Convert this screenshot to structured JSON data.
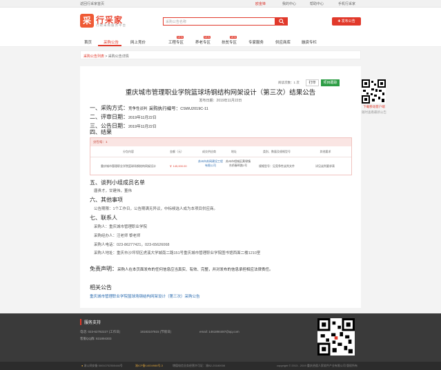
{
  "topbar": {
    "home_link": "返回行采家首页",
    "user": "欧金锋",
    "links": [
      "我的中心",
      "帮助中心",
      "手机行采家"
    ]
  },
  "header": {
    "logo_glyph": "采",
    "logo_title": "行采家",
    "logo_sub": "行政采购服务平台",
    "search_placeholder": "采购公告名称",
    "publish_label": "发布公告"
  },
  "nav": {
    "items": [
      "首页",
      "采购公告",
      "网上竞价",
      "工程专区",
      "养老专区",
      "扶贫专区",
      "专家服务",
      "供应商库",
      "融资专栏"
    ],
    "badges": [
      "NEW",
      "NEW",
      "NEW"
    ]
  },
  "breadcrumb": {
    "list_link": "采购公告列表",
    "separator": ">",
    "current": "采购公告详情"
  },
  "article": {
    "views": "阅读次数：1 次",
    "print_label": "打印",
    "follow_label": "项目跟踪",
    "title": "重庆城市管理职业学院篮球场钢结构网架设计（第三次）结果公告",
    "publish_date": "发布日期：2019年11月22日",
    "s1_label": "一、采购方式：",
    "s1_value": "竞争性谈判",
    "s1_code_label": "采购执行编号：",
    "s1_code": "CSWU2019C-11",
    "s2_label": "二、评审日期：",
    "s2_value": "2019年11月22日",
    "s3_label": "三、公告日期：",
    "s3_value": "2019年11月22日",
    "s4_label": "四、结果",
    "s5_label": "五、谈判小组成员名单",
    "s5_text": "唐贵才，甘建伟，董伟",
    "s6_label": "六、其他事项",
    "s6_text": "公告期限：1个工作日，公告期满无异议，中标候选人成为本项目供应商。",
    "s7_label": "七、联系人",
    "contact_1": "采购人：重庆城市管理职业学院",
    "contact_2": "采购经办人：汪老师 黎老师",
    "contact_3": "采购人电话：023-86277421，023-65626068",
    "contact_4": "采购人地址：重庆市沙坪坝区虎溪大学城南二路151号重庆城市管理职业学院图书馆西面二楼1210室",
    "disclaimer_label": "免责声明：",
    "disclaimer_text": "采购人在本页面发布的任何信息应当真实、有效、完整，并对发布的信息承担相应法律责任。",
    "related_label": "相关公告",
    "related_link": "重庆城市管理职业学院篮球场钢结构网架设计（第三次）采购公告"
  },
  "result_table": {
    "package": "分包号：1",
    "headers": [
      "分包内容",
      "金额（元）",
      "成交供应商",
      "地址",
      "类别、数量及规格型号",
      "其他要求"
    ],
    "row": [
      "重庆城市管理职业学院篮球场钢结构网架设计",
      "￥ 145,000.00",
      "苏州市苏网建设工程有限公司",
      "苏州市相城区黄埭镇东桥春晖路1号",
      "规格型号：见竞争性谈判文件",
      "详见谈判要求表"
    ]
  },
  "side_qr": {
    "caption_1": "下载移动客户端",
    "caption_2": "随时查看最新公告"
  },
  "footer": {
    "title": "服务支持",
    "phone": "电话: 023-62782227 (工作日)",
    "mobile": "18183107815 (节假日)",
    "email": "email: 1461894487@qq.com",
    "qq": "客服QQ群: 831894303",
    "bottom_left": "渝公网安备 50010702500446号",
    "bottom_mid": "渝ICP备14004988号-3",
    "bottom_mid2": "增值电信业务经营许可证：渝B2-20180008",
    "copyright": "copyright © 2013 - 2019 重庆逍遥人家软件产业有限公司 版权所有"
  },
  "colors": {
    "accent": "#e1392b",
    "link": "#2b6cb0",
    "follow": "#2d9d45",
    "footer": "#3a3a3a"
  }
}
